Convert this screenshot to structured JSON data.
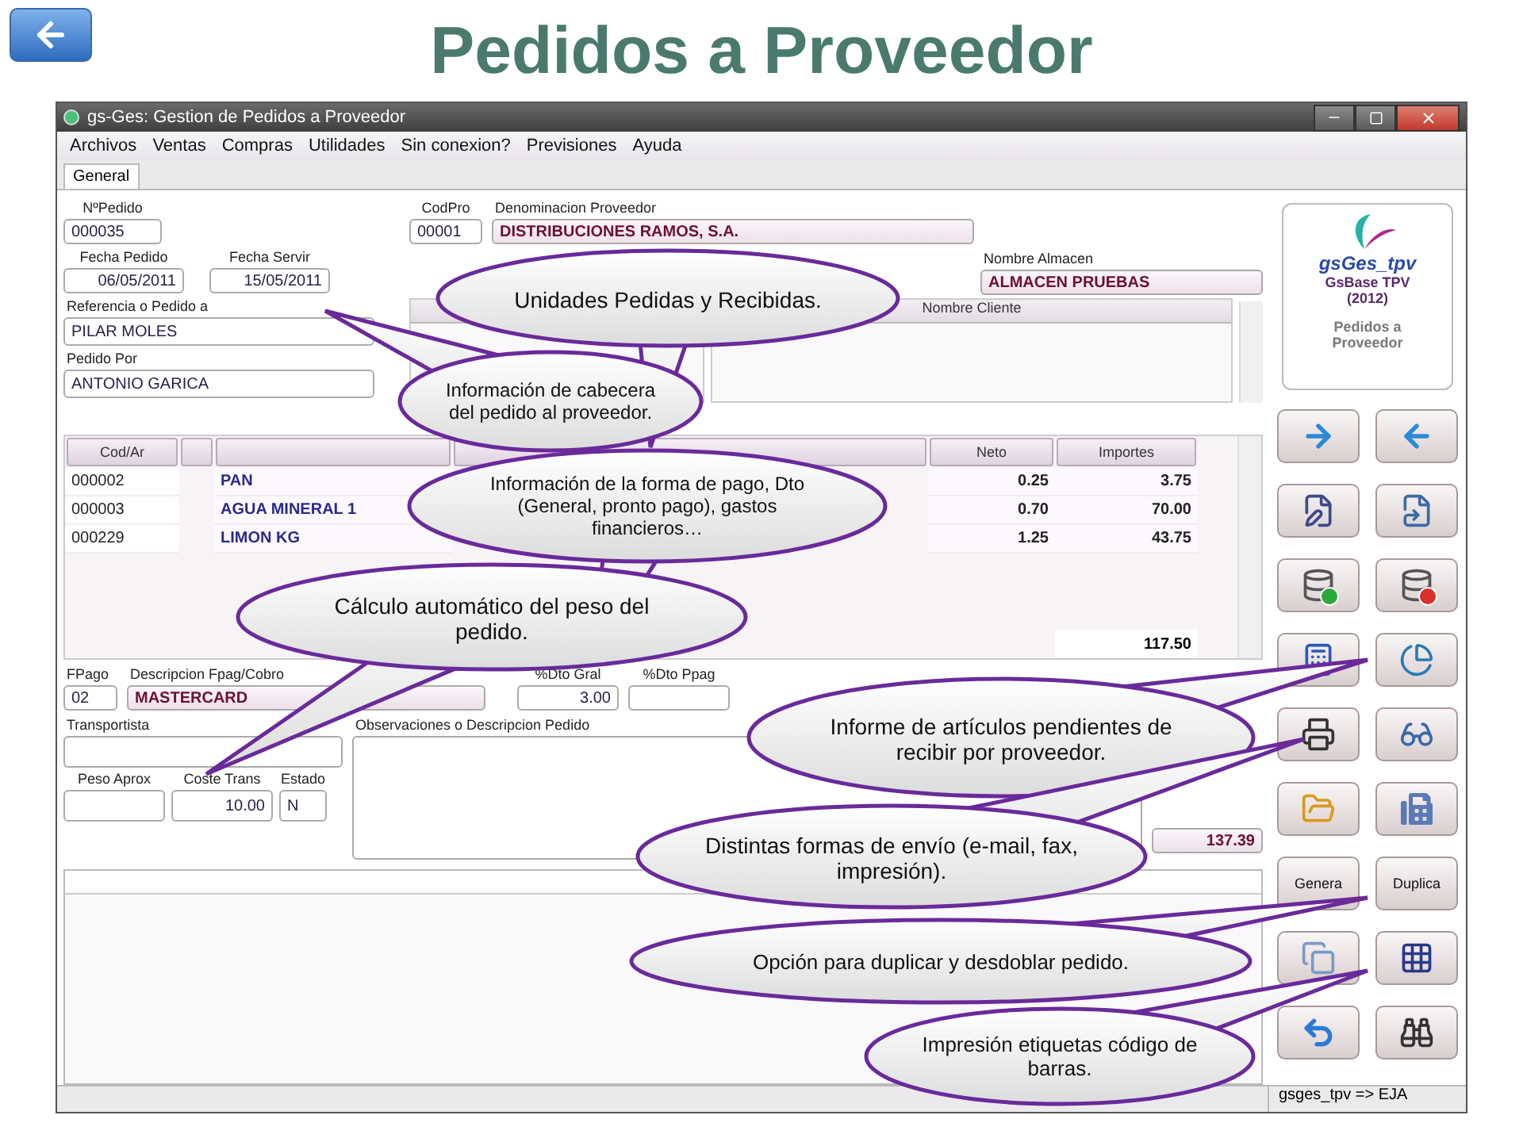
{
  "slide_title": "Pedidos a Proveedor",
  "window": {
    "title": "gs-Ges: Gestion de Pedidos a Proveedor"
  },
  "menu": [
    "Archivos",
    "Ventas",
    "Compras",
    "Utilidades",
    "Sin conexion?",
    "Previsiones",
    "Ayuda"
  ],
  "tabs": [
    {
      "label": "General",
      "selected": true
    }
  ],
  "header": {
    "numero": {
      "label": "NºPedido",
      "value": "000035"
    },
    "fecha_pedido": {
      "label": "Fecha Pedido",
      "value": "06/05/2011"
    },
    "fecha_servir": {
      "label": "Fecha Servir",
      "value": "15/05/2011"
    },
    "referencia": {
      "label": "Referencia o Pedido a",
      "value": "PILAR MOLES"
    },
    "pedido_por": {
      "label": "Pedido Por",
      "value": "ANTONIO GARICA"
    },
    "codpro": {
      "label": "CodPro",
      "value": "00001"
    },
    "proveedor": {
      "label": "Denominacion Proveedor",
      "value": "DISTRIBUCIONES RAMOS, S.A."
    },
    "almacen": {
      "label": "Nombre Almacen",
      "value": "ALMACEN PRUEBAS"
    },
    "clientes_grid": {
      "columns": [
        "Nombre Cliente"
      ]
    }
  },
  "table": {
    "columns": [
      {
        "label": "Cod/Ar",
        "kind": "code"
      },
      {
        "kind": "blank"
      },
      {
        "kind": "desc"
      },
      {
        "kind": "hidden"
      },
      {
        "label": "Neto",
        "kind": "num"
      },
      {
        "label": "Importes",
        "kind": "num"
      }
    ],
    "rows": [
      {
        "cod": "000002",
        "descripcion": "PAN",
        "neto": "0.25",
        "importe": "3.75"
      },
      {
        "cod": "000003",
        "descripcion": "AGUA MINERAL 1",
        "neto": "0.70",
        "importe": "70.00"
      },
      {
        "cod": "000229",
        "descripcion": "LIMON KG",
        "neto": "1.25",
        "importe": "43.75"
      }
    ],
    "total": "117.50"
  },
  "pago": {
    "fpago": {
      "label": "FPago",
      "value": "02"
    },
    "descripcion": {
      "label": "Descripcion Fpag/Cobro",
      "value": "MASTERCARD"
    },
    "dto_gral": {
      "label": "%Dto Gral",
      "value": "3.00"
    },
    "dto_ppag": {
      "label": "%Dto Ppag"
    }
  },
  "envio": {
    "transportista": {
      "label": "Transportista"
    },
    "peso": {
      "label": "Peso Aprox"
    },
    "coste": {
      "label": "Coste Trans",
      "value": "10.00"
    },
    "estado": {
      "label": "Estado",
      "value": "N"
    },
    "observaciones": {
      "label": "Observaciones o Descripcion Pedido"
    },
    "total": "137.39"
  },
  "logo": {
    "brand": "gsGes_tpv",
    "product": "GsBase TPV",
    "year": "(2012)",
    "module": "Pedidos a Proveedor"
  },
  "buttons": [
    {
      "kind": "icon"
    },
    {
      "kind": "icon"
    },
    {
      "kind": "icon"
    },
    {
      "kind": "icon"
    },
    {
      "kind": "icon"
    },
    {
      "kind": "icon"
    },
    {
      "kind": "icon"
    },
    {
      "kind": "icon"
    },
    {
      "kind": "icon"
    },
    {
      "kind": "icon"
    },
    {
      "kind": "icon"
    },
    {
      "kind": "icon"
    },
    {
      "kind": "text",
      "label": "Genera"
    },
    {
      "kind": "text",
      "label": "Duplica"
    },
    {
      "kind": "icon"
    },
    {
      "kind": "icon"
    },
    {
      "kind": "icon"
    },
    {
      "kind": "icon"
    }
  ],
  "status_bar": {
    "session": "gsges_tpv => EJA"
  },
  "callouts": [
    {
      "text": "Unidades Pedidas y Recibidas."
    },
    {
      "text": "Información de cabecera del pedido al proveedor."
    },
    {
      "text": "Información de la forma de pago, Dto (General, pronto pago), gastos financieros…"
    },
    {
      "text": "Cálculo automático del peso del pedido."
    },
    {
      "text": "Informe de artículos pendientes de recibir por proveedor."
    },
    {
      "text": "Distintas formas de envío (e-mail, fax, impresión)."
    },
    {
      "text": "Opción para duplicar y desdoblar pedido."
    },
    {
      "text": "Impresión etiquetas código de barras."
    }
  ]
}
